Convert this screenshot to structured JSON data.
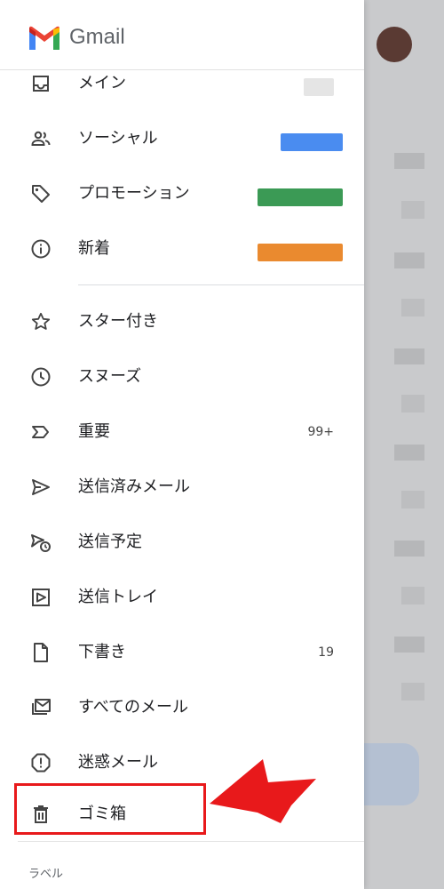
{
  "app": {
    "name": "Gmail"
  },
  "nav": {
    "main": {
      "label": "メイン"
    },
    "social": {
      "label": "ソーシャル"
    },
    "promotions": {
      "label": "プロモーション"
    },
    "updates": {
      "label": "新着"
    },
    "starred": {
      "label": "スター付き"
    },
    "snoozed": {
      "label": "スヌーズ"
    },
    "important": {
      "label": "重要",
      "count": "99+"
    },
    "sent": {
      "label": "送信済みメール"
    },
    "scheduled": {
      "label": "送信予定"
    },
    "outbox": {
      "label": "送信トレイ"
    },
    "drafts": {
      "label": "下書き",
      "count": "19"
    },
    "all_mail": {
      "label": "すべてのメール"
    },
    "spam": {
      "label": "迷惑メール"
    },
    "trash": {
      "label": "ゴミ箱"
    }
  },
  "sections": {
    "labels": "ラベル"
  },
  "colors": {
    "social_badge": "#4a8cf0",
    "promotions_badge": "#3b9a55",
    "updates_badge": "#ea8a2f",
    "highlight": "#e8191b"
  },
  "icons": [
    "gmail-logo-icon",
    "inbox-icon",
    "people-icon",
    "tag-icon",
    "info-icon",
    "star-icon",
    "clock-icon",
    "important-icon",
    "send-icon",
    "scheduled-send-icon",
    "outbox-icon",
    "draft-icon",
    "all-mail-icon",
    "spam-icon",
    "trash-icon",
    "arrow-icon"
  ]
}
